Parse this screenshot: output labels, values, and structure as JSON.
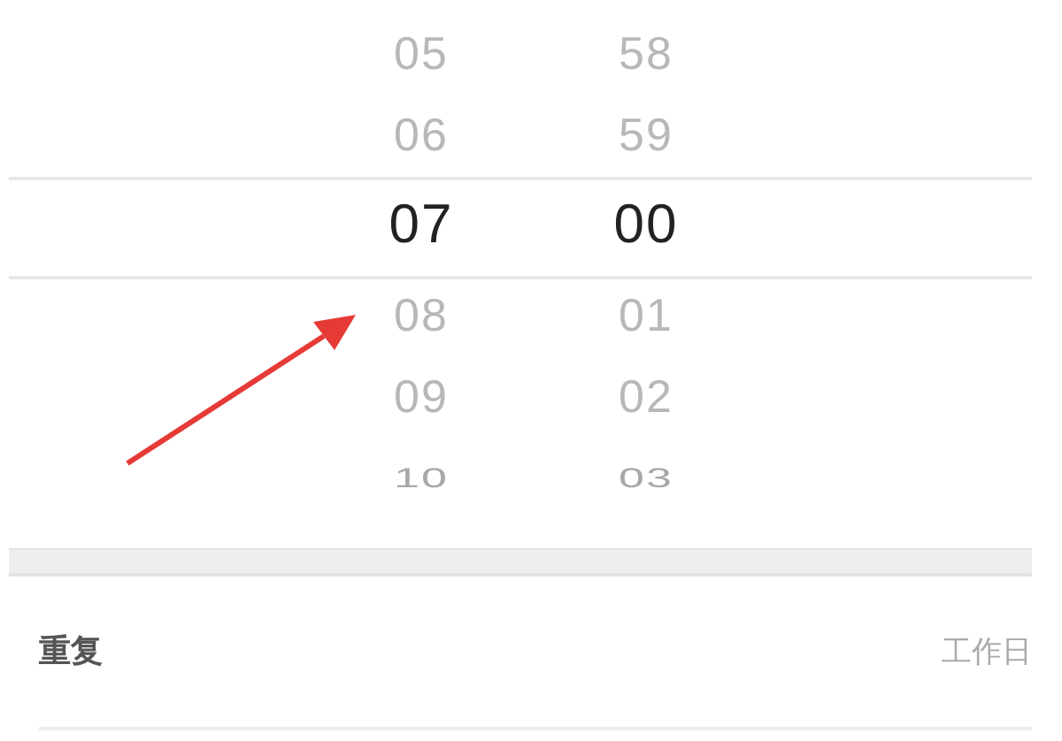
{
  "picker": {
    "columns": [
      {
        "items": [
          {
            "text": "05",
            "selected": false
          },
          {
            "text": "06",
            "selected": false
          },
          {
            "text": "07",
            "selected": true
          },
          {
            "text": "08",
            "selected": false
          },
          {
            "text": "09",
            "selected": false
          },
          {
            "text": "10",
            "selected": false
          }
        ]
      },
      {
        "items": [
          {
            "text": "58",
            "selected": false
          },
          {
            "text": "59",
            "selected": false
          },
          {
            "text": "00",
            "selected": true
          },
          {
            "text": "01",
            "selected": false
          },
          {
            "text": "02",
            "selected": false
          },
          {
            "text": "03",
            "selected": false
          }
        ]
      }
    ]
  },
  "setting_row": {
    "label": "重复",
    "value": "工作日"
  }
}
